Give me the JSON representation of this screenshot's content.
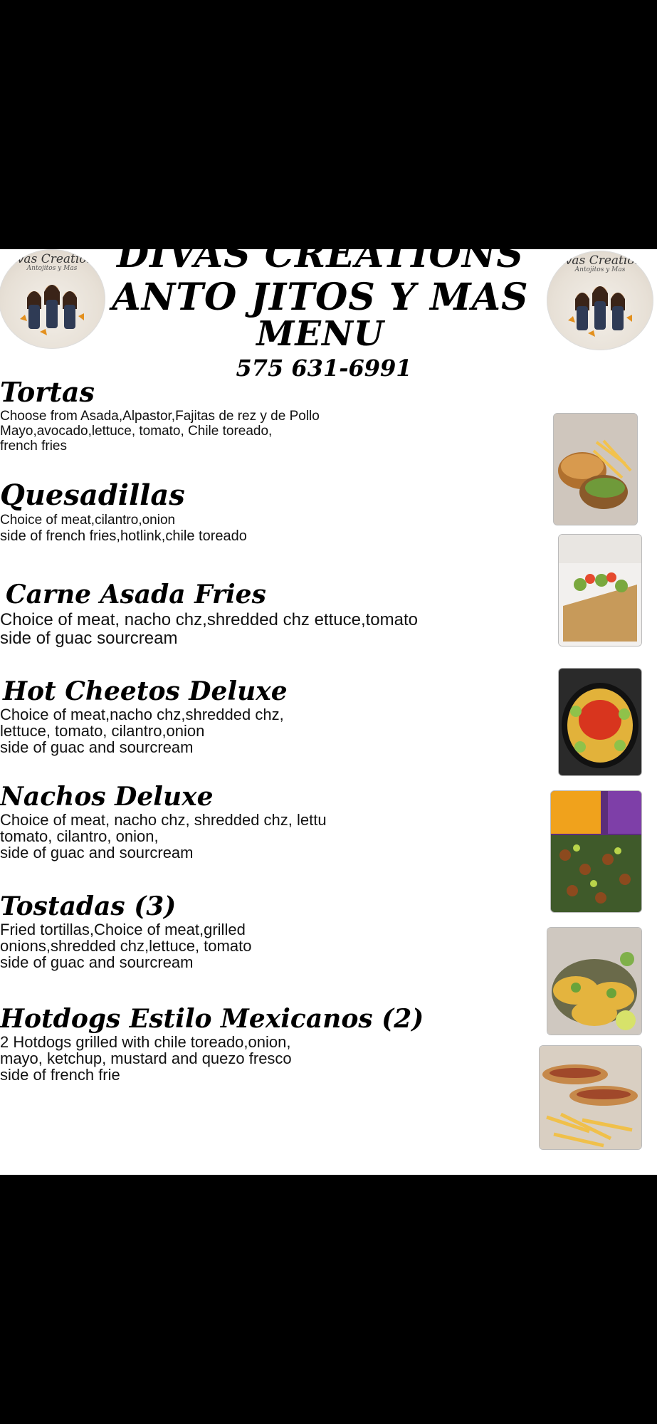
{
  "header": {
    "title_line1": "DIVAS CREATIONS",
    "title_line2": "ANTO JITOS Y MAS",
    "title_line3": "MENU",
    "phone": "575 631-6991"
  },
  "logo": {
    "name": "Divas Creations",
    "sub": "Antojitos y Mas"
  },
  "items": [
    {
      "name": "Tortas",
      "lines": [
        "Choose from Asada,Alpastor,Fajitas de rez y de Pollo",
        "Mayo,avocado,lettuce, tomato, Chile toreado,",
        "french fries"
      ]
    },
    {
      "name": "Quesadillas",
      "lines": [
        "Choice of meat,cilantro,onion",
        "side of french fries,hotlink,chile toreado"
      ]
    },
    {
      "name": "Carne Asada Fries",
      "lines": [
        "Choice of meat, nacho chz,shredded chz ettuce,tomato",
        "side of guac sourcream"
      ]
    },
    {
      "name": "Hot Cheetos Deluxe",
      "lines": [
        "Choice of meat,nacho chz,shredded chz,",
        "lettuce, tomato, cilantro,onion",
        "side of guac and sourcream"
      ]
    },
    {
      "name": "Nachos Deluxe",
      "lines": [
        "Choice of meat, nacho chz, shredded chz, lettu",
        "tomato, cilantro, onion,",
        "side of guac and sourcream"
      ]
    },
    {
      "name": "Tostadas (3)",
      "lines": [
        "Fried tortillas,Choice of meat,grilled",
        "onions,shredded chz,lettuce, tomato",
        "side of guac and sourcream"
      ]
    },
    {
      "name": "Hotdogs Estilo Mexicanos (2)",
      "lines": [
        "2 Hotdogs grilled with chile toreado,onion,",
        "mayo, ketchup, mustard and quezo fresco",
        "side of french frie"
      ]
    }
  ],
  "colors": {
    "background": "#000000",
    "sheet": "#ffffff",
    "text": "#000000"
  }
}
